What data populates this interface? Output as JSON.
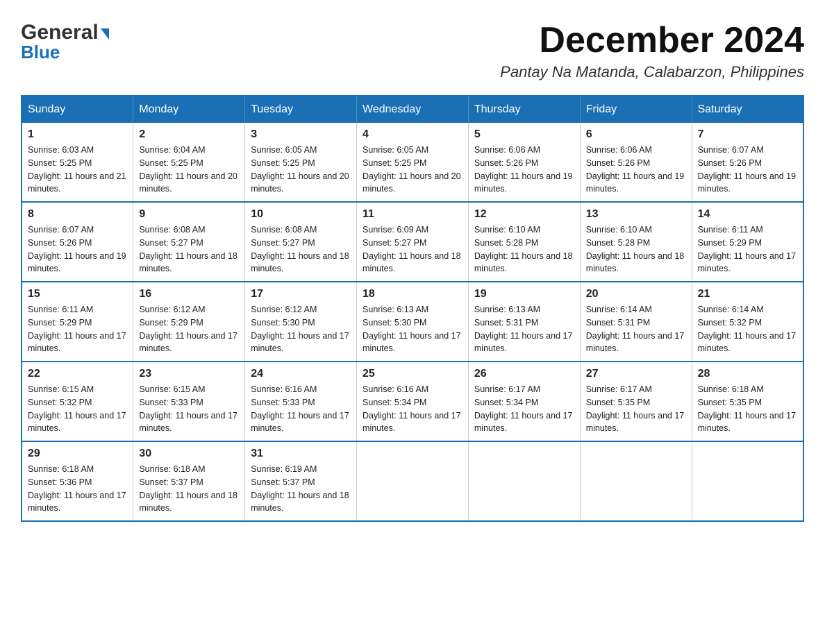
{
  "logo": {
    "general": "General",
    "blue": "Blue",
    "triangle": "▶"
  },
  "header": {
    "month": "December 2024",
    "location": "Pantay Na Matanda, Calabarzon, Philippines"
  },
  "days_of_week": [
    "Sunday",
    "Monday",
    "Tuesday",
    "Wednesday",
    "Thursday",
    "Friday",
    "Saturday"
  ],
  "weeks": [
    [
      {
        "day": "1",
        "sunrise": "6:03 AM",
        "sunset": "5:25 PM",
        "daylight": "11 hours and 21 minutes."
      },
      {
        "day": "2",
        "sunrise": "6:04 AM",
        "sunset": "5:25 PM",
        "daylight": "11 hours and 20 minutes."
      },
      {
        "day": "3",
        "sunrise": "6:05 AM",
        "sunset": "5:25 PM",
        "daylight": "11 hours and 20 minutes."
      },
      {
        "day": "4",
        "sunrise": "6:05 AM",
        "sunset": "5:25 PM",
        "daylight": "11 hours and 20 minutes."
      },
      {
        "day": "5",
        "sunrise": "6:06 AM",
        "sunset": "5:26 PM",
        "daylight": "11 hours and 19 minutes."
      },
      {
        "day": "6",
        "sunrise": "6:06 AM",
        "sunset": "5:26 PM",
        "daylight": "11 hours and 19 minutes."
      },
      {
        "day": "7",
        "sunrise": "6:07 AM",
        "sunset": "5:26 PM",
        "daylight": "11 hours and 19 minutes."
      }
    ],
    [
      {
        "day": "8",
        "sunrise": "6:07 AM",
        "sunset": "5:26 PM",
        "daylight": "11 hours and 19 minutes."
      },
      {
        "day": "9",
        "sunrise": "6:08 AM",
        "sunset": "5:27 PM",
        "daylight": "11 hours and 18 minutes."
      },
      {
        "day": "10",
        "sunrise": "6:08 AM",
        "sunset": "5:27 PM",
        "daylight": "11 hours and 18 minutes."
      },
      {
        "day": "11",
        "sunrise": "6:09 AM",
        "sunset": "5:27 PM",
        "daylight": "11 hours and 18 minutes."
      },
      {
        "day": "12",
        "sunrise": "6:10 AM",
        "sunset": "5:28 PM",
        "daylight": "11 hours and 18 minutes."
      },
      {
        "day": "13",
        "sunrise": "6:10 AM",
        "sunset": "5:28 PM",
        "daylight": "11 hours and 18 minutes."
      },
      {
        "day": "14",
        "sunrise": "6:11 AM",
        "sunset": "5:29 PM",
        "daylight": "11 hours and 17 minutes."
      }
    ],
    [
      {
        "day": "15",
        "sunrise": "6:11 AM",
        "sunset": "5:29 PM",
        "daylight": "11 hours and 17 minutes."
      },
      {
        "day": "16",
        "sunrise": "6:12 AM",
        "sunset": "5:29 PM",
        "daylight": "11 hours and 17 minutes."
      },
      {
        "day": "17",
        "sunrise": "6:12 AM",
        "sunset": "5:30 PM",
        "daylight": "11 hours and 17 minutes."
      },
      {
        "day": "18",
        "sunrise": "6:13 AM",
        "sunset": "5:30 PM",
        "daylight": "11 hours and 17 minutes."
      },
      {
        "day": "19",
        "sunrise": "6:13 AM",
        "sunset": "5:31 PM",
        "daylight": "11 hours and 17 minutes."
      },
      {
        "day": "20",
        "sunrise": "6:14 AM",
        "sunset": "5:31 PM",
        "daylight": "11 hours and 17 minutes."
      },
      {
        "day": "21",
        "sunrise": "6:14 AM",
        "sunset": "5:32 PM",
        "daylight": "11 hours and 17 minutes."
      }
    ],
    [
      {
        "day": "22",
        "sunrise": "6:15 AM",
        "sunset": "5:32 PM",
        "daylight": "11 hours and 17 minutes."
      },
      {
        "day": "23",
        "sunrise": "6:15 AM",
        "sunset": "5:33 PM",
        "daylight": "11 hours and 17 minutes."
      },
      {
        "day": "24",
        "sunrise": "6:16 AM",
        "sunset": "5:33 PM",
        "daylight": "11 hours and 17 minutes."
      },
      {
        "day": "25",
        "sunrise": "6:16 AM",
        "sunset": "5:34 PM",
        "daylight": "11 hours and 17 minutes."
      },
      {
        "day": "26",
        "sunrise": "6:17 AM",
        "sunset": "5:34 PM",
        "daylight": "11 hours and 17 minutes."
      },
      {
        "day": "27",
        "sunrise": "6:17 AM",
        "sunset": "5:35 PM",
        "daylight": "11 hours and 17 minutes."
      },
      {
        "day": "28",
        "sunrise": "6:18 AM",
        "sunset": "5:35 PM",
        "daylight": "11 hours and 17 minutes."
      }
    ],
    [
      {
        "day": "29",
        "sunrise": "6:18 AM",
        "sunset": "5:36 PM",
        "daylight": "11 hours and 17 minutes."
      },
      {
        "day": "30",
        "sunrise": "6:18 AM",
        "sunset": "5:37 PM",
        "daylight": "11 hours and 18 minutes."
      },
      {
        "day": "31",
        "sunrise": "6:19 AM",
        "sunset": "5:37 PM",
        "daylight": "11 hours and 18 minutes."
      },
      null,
      null,
      null,
      null
    ]
  ]
}
